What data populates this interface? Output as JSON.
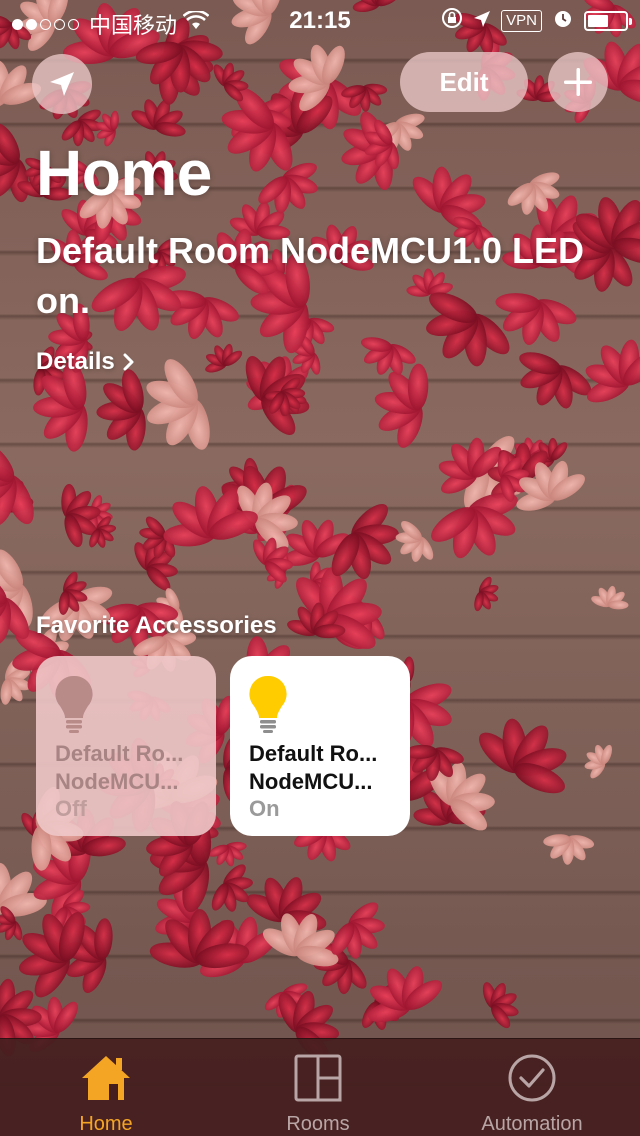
{
  "status_bar": {
    "signal_filled": 2,
    "signal_total": 5,
    "carrier": "中国移动",
    "time": "21:15",
    "vpn": "VPN",
    "battery_level": 0.55
  },
  "header": {
    "location_icon": "location-arrow-icon",
    "edit_label": "Edit",
    "add_icon": "plus-icon"
  },
  "home": {
    "title": "Home",
    "summary": "Default Room NodeMCU1.0 LED on.",
    "details_label": "Details"
  },
  "favorites": {
    "section_title": "Favorite Accessories",
    "tiles": [
      {
        "line1": "Default Ro...",
        "line2": "NodeMCU...",
        "state": "Off",
        "icon": "lightbulb-icon",
        "color": "#b88a88"
      },
      {
        "line1": "Default Ro...",
        "line2": "NodeMCU...",
        "state": "On",
        "icon": "lightbulb-icon",
        "color": "#ffcc00"
      }
    ]
  },
  "tab_bar": {
    "tabs": [
      {
        "label": "Home",
        "icon": "house-icon",
        "active": true
      },
      {
        "label": "Rooms",
        "icon": "rooms-icon",
        "active": false
      },
      {
        "label": "Automation",
        "icon": "clock-icon",
        "active": false
      }
    ]
  },
  "colors": {
    "accent": "#f5a524",
    "tab_bar_bg": "#441e1e"
  }
}
